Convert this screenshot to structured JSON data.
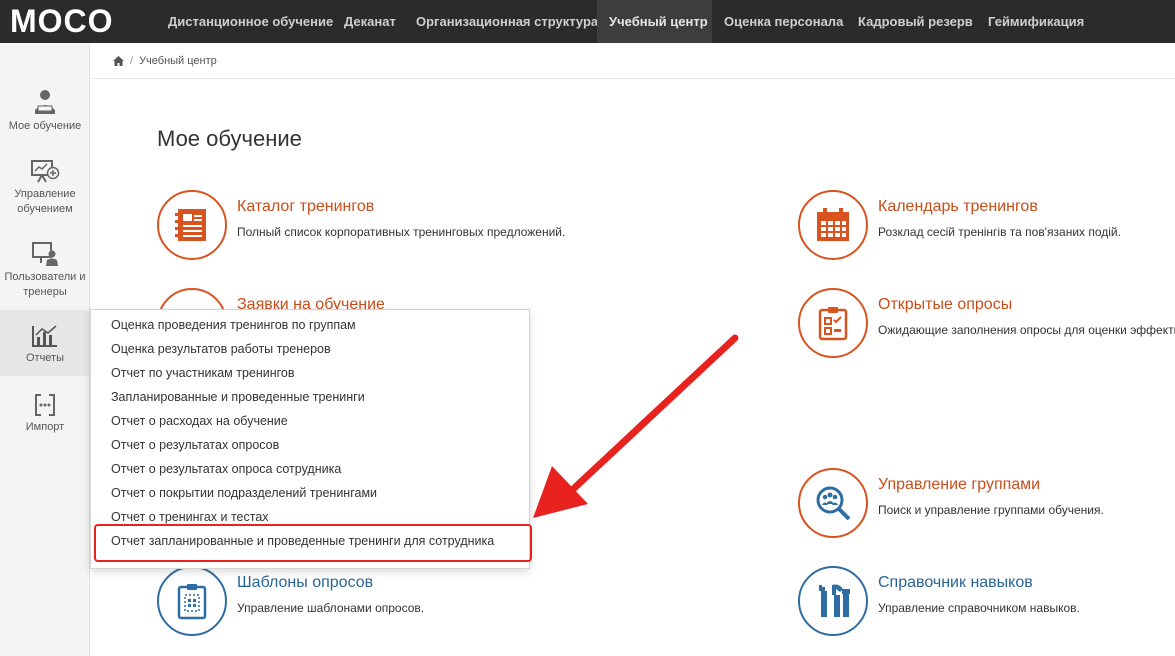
{
  "topbar": {
    "logo_text": "MOCO",
    "nav": [
      {
        "label": "Дистанционное обучение"
      },
      {
        "label": "Деканат"
      },
      {
        "label": "Организационная структура"
      },
      {
        "label": "Учебный центр",
        "active": true
      },
      {
        "label": "Оценка персонала"
      },
      {
        "label": "Кадровый резерв"
      },
      {
        "label": "Геймификация"
      }
    ]
  },
  "sidebar": {
    "items": [
      {
        "label": "Мое обучение",
        "icon": "student-icon"
      },
      {
        "label": "Управление обучением",
        "icon": "presentation-add-icon"
      },
      {
        "label": "Пользователи и тренеры",
        "icon": "trainer-board-icon"
      },
      {
        "label": "Отчеты",
        "icon": "chart-icon",
        "active": true
      },
      {
        "label": "Импорт",
        "icon": "import-icon"
      }
    ]
  },
  "breadcrumb": {
    "home_icon": "home-icon",
    "current": "Учебный центр"
  },
  "page": {
    "title": "Мое обучение"
  },
  "tiles": [
    {
      "title": "Каталог тренингов",
      "desc": "Полный список корпоративных тренинговых предложений.",
      "icon": "catalog-icon",
      "color": "#d9531e"
    },
    {
      "title": "Календарь тренингов",
      "desc": "Розклад сесій тренінгів та пов'язаних подій.",
      "icon": "calendar-icon",
      "color": "#d9531e"
    },
    {
      "title": "Заявки на обучение",
      "desc": "",
      "icon": "requests-icon",
      "color": "#d9531e"
    },
    {
      "title": "Открытые опросы",
      "desc": "Ожидающие заполнения опросы для оценки эффективности",
      "icon": "survey-icon",
      "color": "#d9531e"
    },
    {
      "title": "Управление группами",
      "desc": "Поиск и управление группами обучения.",
      "icon": "group-search-icon",
      "color": "#2e6da4"
    },
    {
      "title": "Шаблоны опросов",
      "desc": "Управление шаблонами опросов.",
      "icon": "survey-template-icon",
      "color": "#2e6da4"
    },
    {
      "title": "Справочник навыков",
      "desc": "Управление справочником навыков.",
      "icon": "tools-icon",
      "color": "#2e6da4"
    }
  ],
  "reports_menu": {
    "items": [
      "Оценка проведения тренингов по группам",
      "Оценка результатов работы тренеров",
      "Отчет по участникам тренингов",
      "Запланированные и проведенные тренинги",
      "Отчет о расходах на обучение",
      "Отчет о результатах опросов",
      "Отчет о результатах опроса сотрудника",
      "Отчет о покрытии подразделений тренингами",
      "Отчет о тренингах и тестах",
      "Отчет запланированные и проведенные тренинги для сотрудника"
    ],
    "highlighted_index": 9
  },
  "colors": {
    "topbar_bg": "#2b2b2b",
    "accent_orange": "#d9531e",
    "accent_blue": "#2e6da4",
    "annotation_red": "#e8231f"
  }
}
